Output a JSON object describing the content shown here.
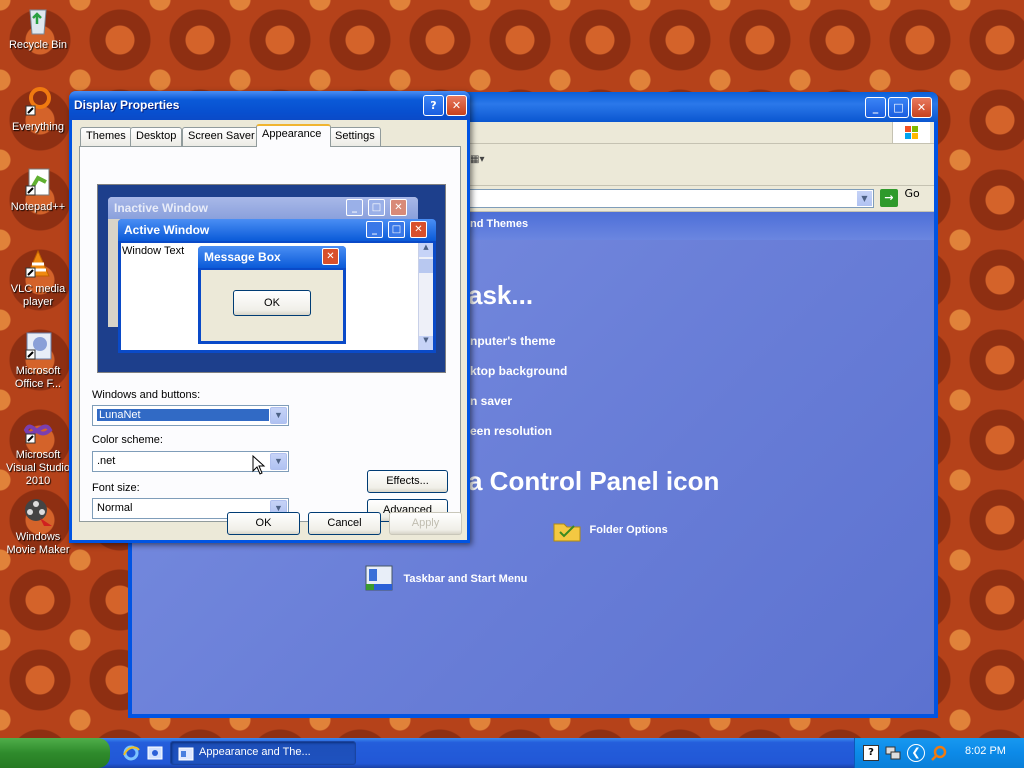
{
  "desktop": {
    "icons": [
      {
        "label": "Recycle Bin",
        "icon": "recycle-bin-icon"
      },
      {
        "label": "Everything",
        "icon": "everything-icon"
      },
      {
        "label": "Notepad++",
        "icon": "notepad-plus-icon"
      },
      {
        "label": "VLC media player",
        "icon": "vlc-icon"
      },
      {
        "label": "Microsoft Office F...",
        "icon": "office-icon"
      },
      {
        "label": "Microsoft Visual Studio 2010",
        "icon": "visual-studio-icon"
      },
      {
        "label": "Windows Movie Maker",
        "icon": "movie-maker-icon"
      }
    ]
  },
  "background_window": {
    "address_go": "Go",
    "breadcrumb": "nd Themes",
    "task_heading": "ask...",
    "tasks": [
      "nputer's theme",
      "ktop background",
      "n saver",
      "een resolution"
    ],
    "icon_heading": "a Control Panel icon",
    "panel_icons": [
      {
        "label": "Folder Options",
        "icon": "folder-options-icon"
      },
      {
        "label": "Taskbar and Start Menu",
        "icon": "taskbar-start-menu-icon"
      }
    ]
  },
  "dialog": {
    "title": "Display Properties",
    "tabs": [
      "Themes",
      "Desktop",
      "Screen Saver",
      "Appearance",
      "Settings"
    ],
    "active_tab": "Appearance",
    "preview": {
      "inactive_title": "Inactive Window",
      "active_title": "Active Window",
      "window_text": "Window Text",
      "message_title": "Message Box",
      "ok_label": "OK"
    },
    "windows_buttons_label": "Windows and buttons:",
    "windows_buttons_value": "LunaNet",
    "color_scheme_label": "Color scheme:",
    "color_scheme_value": ".net",
    "font_size_label": "Font size:",
    "font_size_value": "Normal",
    "effects_label": "Effects...",
    "advanced_label": "Advanced",
    "ok_label": "OK",
    "cancel_label": "Cancel",
    "apply_label": "Apply"
  },
  "taskbar": {
    "task_button": "Appearance and The...",
    "clock": "8:02 PM"
  },
  "colors": {
    "xp_blue": "#0054e3",
    "dialog_face": "#ece9d8",
    "tab_accent": "#f0b430",
    "start_green": "#2f8b2c"
  }
}
